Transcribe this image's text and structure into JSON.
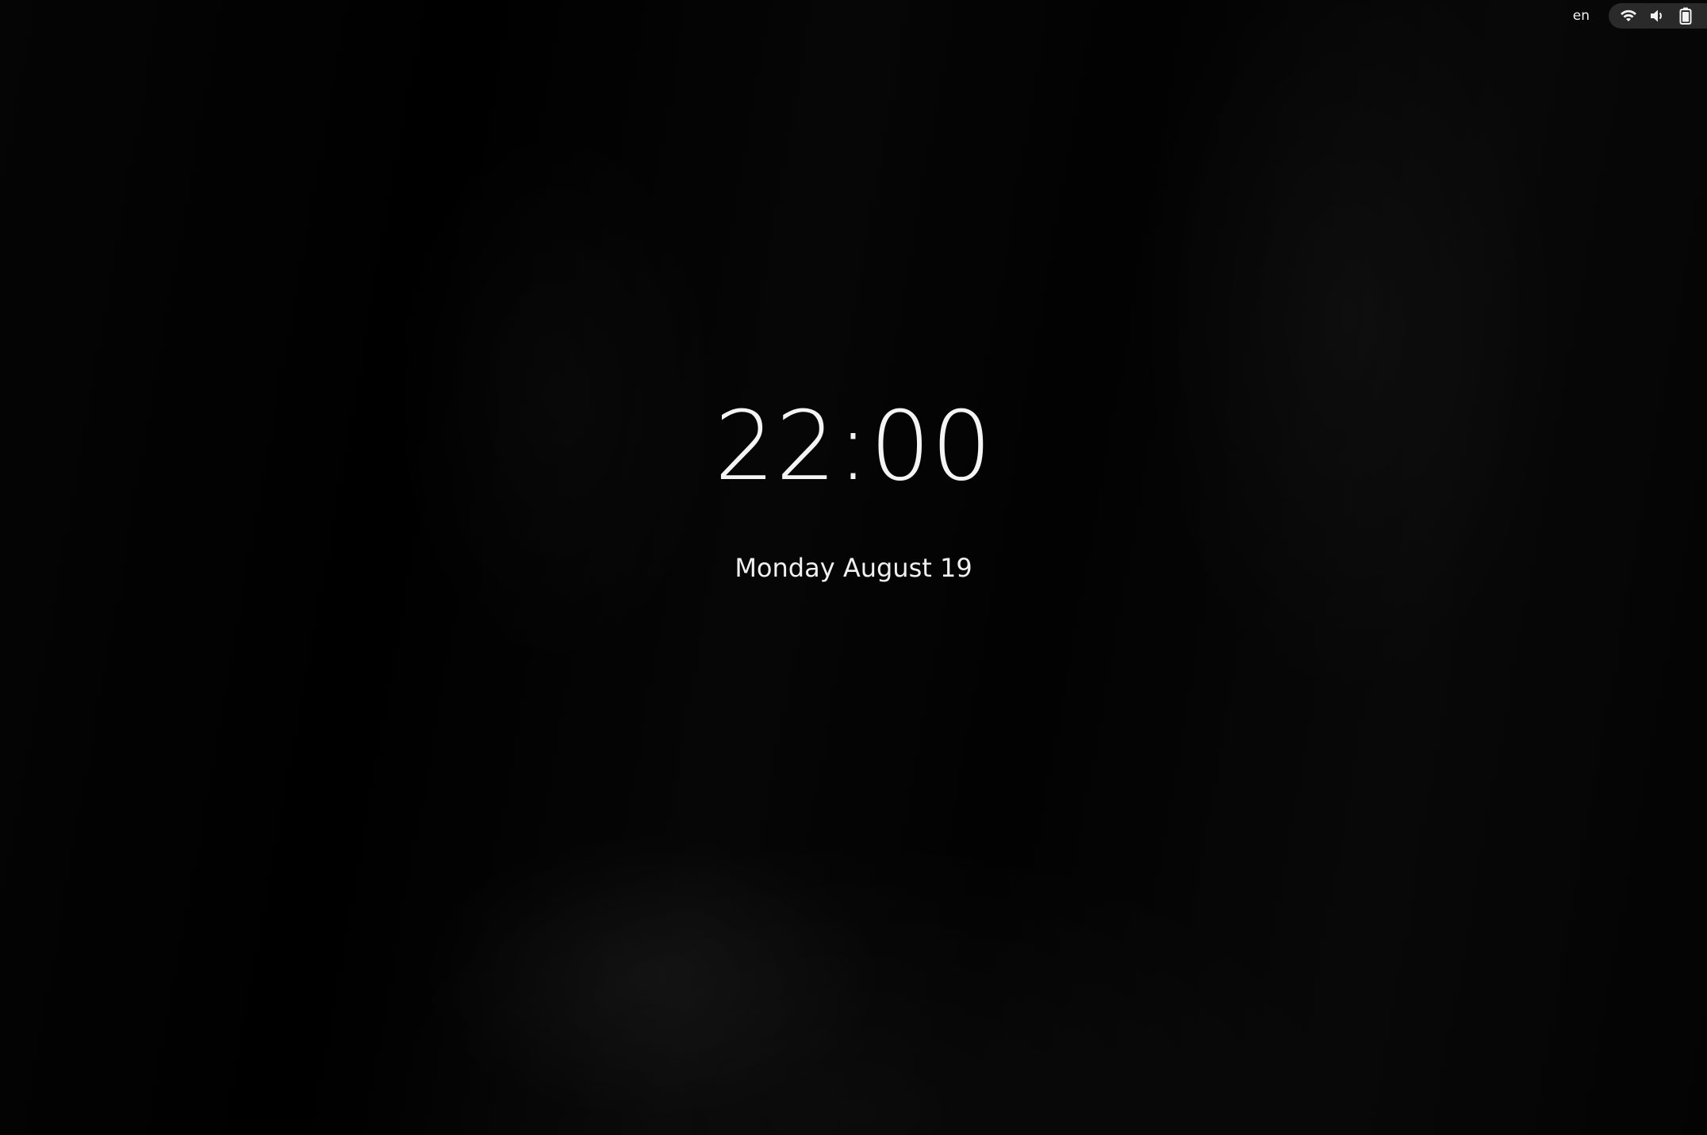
{
  "top_bar": {
    "language": "en",
    "status_icons": [
      "wifi-icon",
      "volume-icon",
      "battery-icon"
    ]
  },
  "lock_screen": {
    "time": "22:00",
    "date": "Monday August 19"
  },
  "colors": {
    "background": "#000000",
    "text": "#f4f4f4",
    "pill": "#262626"
  }
}
